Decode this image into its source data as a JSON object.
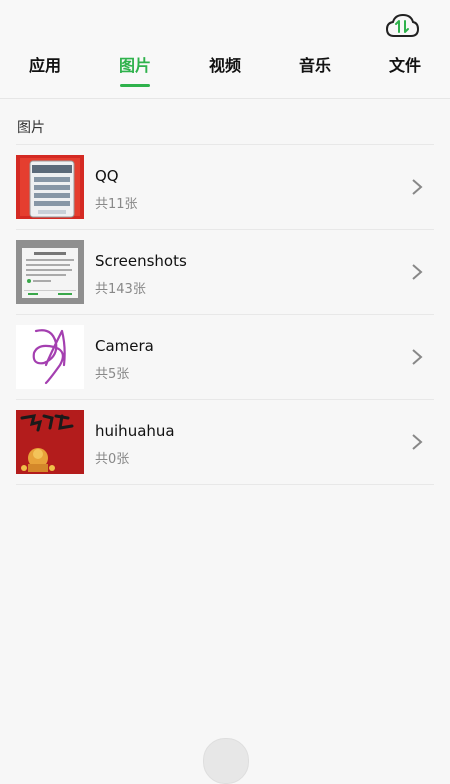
{
  "tabs": [
    {
      "label": "应用",
      "active": false
    },
    {
      "label": "图片",
      "active": true
    },
    {
      "label": "视频",
      "active": false
    },
    {
      "label": "音乐",
      "active": false
    },
    {
      "label": "文件",
      "active": false
    }
  ],
  "colors": {
    "accent": "#2fb24c",
    "text": "#111111",
    "muted": "#888888"
  },
  "section_title": "图片",
  "albums": [
    {
      "name": "QQ",
      "count": "共11张",
      "thumb_icon": "qq-thumbnail"
    },
    {
      "name": "Screenshots",
      "count": "共143张",
      "thumb_icon": "screenshot-thumbnail"
    },
    {
      "name": "Camera",
      "count": "共5张",
      "thumb_icon": "camera-scribble-thumbnail"
    },
    {
      "name": "huihuahua",
      "count": "共0张",
      "thumb_icon": "red-poster-thumbnail"
    }
  ],
  "icons": {
    "sync": "cloud-sync-icon",
    "chevron": "chevron-right-icon"
  }
}
